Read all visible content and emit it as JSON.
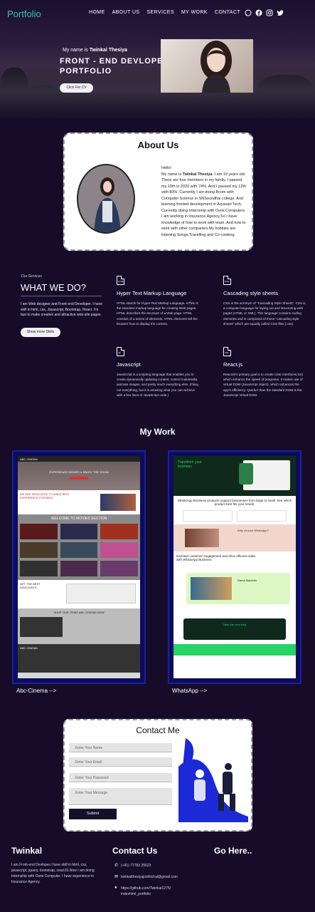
{
  "header": {
    "logo": "Portfolio",
    "nav": [
      "HOME",
      "ABOUT US",
      "SERVICES",
      "MY WORK",
      "CONTACT"
    ],
    "social_icons": [
      "whatsapp-icon",
      "facebook-icon",
      "instagram-icon",
      "twitter-icon"
    ]
  },
  "hero": {
    "intro_prefix": "My name is ",
    "intro_name": "Twinkal Thesiya",
    "title": "FRONT - END DEVLOPER'S PORTFOLIO",
    "cv_button": "Click For CV"
  },
  "about": {
    "title": "About Us",
    "greeting": "Hello!",
    "para_prefix": "My name is ",
    "para_name": "Twinkal Thesiya",
    "para_rest": ". I am 19 years old. There are four members in my family. I passed my 10th in 2020 with 74%. And I passed my 12th with 80%. Currently I am doing Bcom with Computer Science in SNSoundhai college. And learning fronted development in Aryavart Tech. Currently doing Internship with Osmi Computers. I am working in insurance Agency.So I have knowledge of how to work with team. And how to work with other companies.My hobbies are listening Songs,Travelling and Co-cooking."
  },
  "services": {
    "small_label": "Our Services",
    "title": "WHAT WE DO?",
    "description": "I am Web designer and Front-end Developer. I have skill in html, css, Javascript, Bootstrap, React. I'm fast to make creative and attractive web-site pages.",
    "more_button": "Show more Skills",
    "cards": [
      {
        "tag": "HTML",
        "title": "Hyper Text Markup Language",
        "text": "HTML stands for Hyper Text Markup Language. HTML is the standard markup language for creating Web pages. HTML describes the structure of a Web page. HTML consists of a series of elements. HTML elements tell the browser how to display the content."
      },
      {
        "tag": "CSS",
        "title": "Cascading style sheets",
        "text": "CSS is the acronym of \"Cascading Style Sheets\". CSS is a computer language for laying out and structuring web pages (HTML or XML). This language contains coding elements and is composed of these \"cascading style sheets\" which are equally called CSS files (.css)."
      },
      {
        "tag": "JS",
        "title": "Javascript",
        "text": "JavaScript is a scripting language that enables you to create dynamically updating content, control multimedia, animate images, and pretty much everything else. (Okay, not everything, but it is amazing what you can achieve with a few lines of JavaScript code.)"
      },
      {
        "tag": "JSX",
        "title": "React.js",
        "text": "ReactJS's primary goal is to create User Interfaces (UI) which enhance the speed of programs. It makes use of virtual DOM (JavaScript object), which enhances the app's efficiency. Quicker than the standard DOM is the JavaScript virtual DOM."
      }
    ]
  },
  "work": {
    "title": "My Work",
    "projects": [
      {
        "label": "Abc-Cinema -->",
        "site_name": "ABC CINEMA",
        "hero_line1": "EXPERIENCE MOVIES & ENJOY THE SHOW",
        "section1": "WE ARE DEDICATED TO MAKE BEST EXPERIENCE POSSIBLE",
        "section2": "WELCOME TO MOVIES SECTION",
        "section3": "GET THE BEST DISCOUNTS",
        "section4": "SHOP OUR ITEMS ABC-CINEMA NOW",
        "footer_text": "ABC CINEMA"
      },
      {
        "label": "WhatsApp -->",
        "hero_line": "Transform your business",
        "tagline": "WhatsApp Business products support businesses from large to small. See which product best fits your needs.",
        "middle_title": "Why choose WhatsApp?",
        "lower_title": "Kickstart customer engagement and drive efficient sales with WhatsApp Business",
        "case_title": "Rama Marketin",
        "cta_title": "Take the next step"
      }
    ]
  },
  "contact": {
    "title": "Contact Me",
    "name_placeholder": "Enter Your Name",
    "email_placeholder": "Enter Your Email",
    "password_placeholder": "Enter Your Password",
    "message_placeholder": "Enter Your Message",
    "submit": "Submit"
  },
  "footer": {
    "col1_title": "Twinkal",
    "col1_text": "I am Front-end Devloper.I have skill in html, css, javascript, jquery, bootstrap, reactJS.Now I am doing Internship with Osmi Computer. I have experience in Insurance Agency.",
    "col2_title": "Contact Us",
    "phone": "(+91) 77783 25623",
    "email": "twinkalthesiyajoshitchal@gmail.com",
    "github": "https://github.com/Twinkal1275/ indexhtml_portfolio",
    "col3_title": "Go Here.."
  },
  "colors": {
    "background": "#160c2a",
    "logo": "#22d3c5",
    "project_frame": "#1d1f9a"
  }
}
